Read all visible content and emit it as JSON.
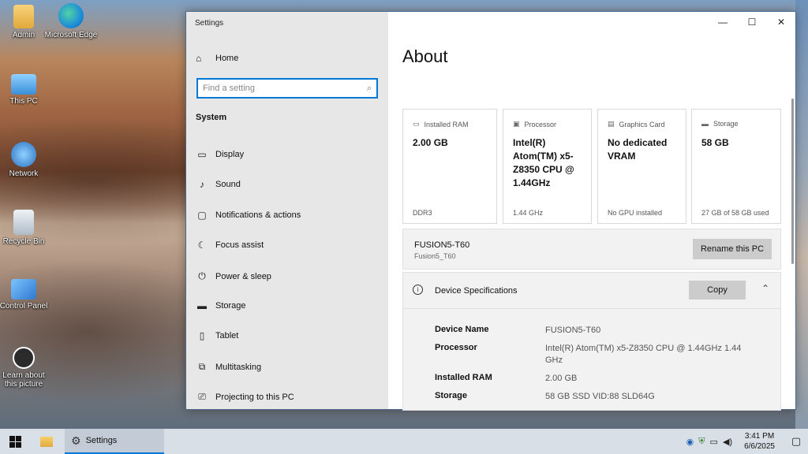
{
  "desktop": {
    "icons": [
      {
        "label": "Admin",
        "icon": "user-folder-icon",
        "color": "#f2c35a"
      },
      {
        "label": "Microsoft Edge",
        "icon": "edge-icon",
        "color": "#1c8fd8"
      },
      {
        "label": "This PC",
        "icon": "computer-icon",
        "color": "#5aa7e6"
      },
      {
        "label": "Network",
        "icon": "network-icon",
        "color": "#4a8fd6"
      },
      {
        "label": "Recycle Bin",
        "icon": "recycle-bin-icon",
        "color": "#cfd8e0"
      },
      {
        "label": "Control Panel",
        "icon": "control-panel-icon",
        "color": "#3f8ee0"
      },
      {
        "label": "Learn about this picture",
        "icon": "camera-icon",
        "color": "#333333"
      }
    ]
  },
  "window": {
    "title": "Settings",
    "controls": {
      "minimize": "—",
      "maximize": "☐",
      "close": "✕"
    }
  },
  "nav": {
    "home": "Home",
    "search_placeholder": "Find a setting",
    "section": "System",
    "items": [
      {
        "label": "Display",
        "icon": "display-icon"
      },
      {
        "label": "Sound",
        "icon": "sound-icon"
      },
      {
        "label": "Notifications & actions",
        "icon": "notifications-icon"
      },
      {
        "label": "Focus assist",
        "icon": "moon-icon"
      },
      {
        "label": "Power & sleep",
        "icon": "power-icon"
      },
      {
        "label": "Storage",
        "icon": "storage-icon"
      },
      {
        "label": "Tablet",
        "icon": "tablet-icon"
      },
      {
        "label": "Multitasking",
        "icon": "multitasking-icon"
      },
      {
        "label": "Projecting to this PC",
        "icon": "projecting-icon"
      }
    ]
  },
  "main": {
    "title": "About",
    "cards": [
      {
        "header": "Installed RAM",
        "value": "2.00 GB",
        "footer": "DDR3"
      },
      {
        "header": "Processor",
        "value": "Intel(R) Atom(TM) x5-Z8350  CPU @ 1.44GHz",
        "footer": "1.44 GHz"
      },
      {
        "header": "Graphics Card",
        "value": "No dedicated VRAM",
        "footer": "No GPU installed"
      },
      {
        "header": "Storage",
        "value": "58 GB",
        "footer": "27 GB of 58 GB used"
      }
    ],
    "pc": {
      "name": "FUSION5-T60",
      "subname": "Fusion5_T60",
      "rename_button": "Rename this PC"
    },
    "specs": {
      "header": "Device Specifications",
      "copy_button": "Copy",
      "rows": [
        {
          "key": "Device Name",
          "value": "FUSION5-T60"
        },
        {
          "key": "Processor",
          "value": "Intel(R) Atom(TM) x5-Z8350  CPU @ 1.44GHz   1.44 GHz"
        },
        {
          "key": "Installed RAM",
          "value": "2.00 GB"
        },
        {
          "key": "Storage",
          "value": "58 GB SSD VID:88 SLD64G"
        }
      ]
    }
  },
  "taskbar": {
    "app_label": "Settings",
    "time": "3:41 PM",
    "date": "6/6/2025"
  }
}
